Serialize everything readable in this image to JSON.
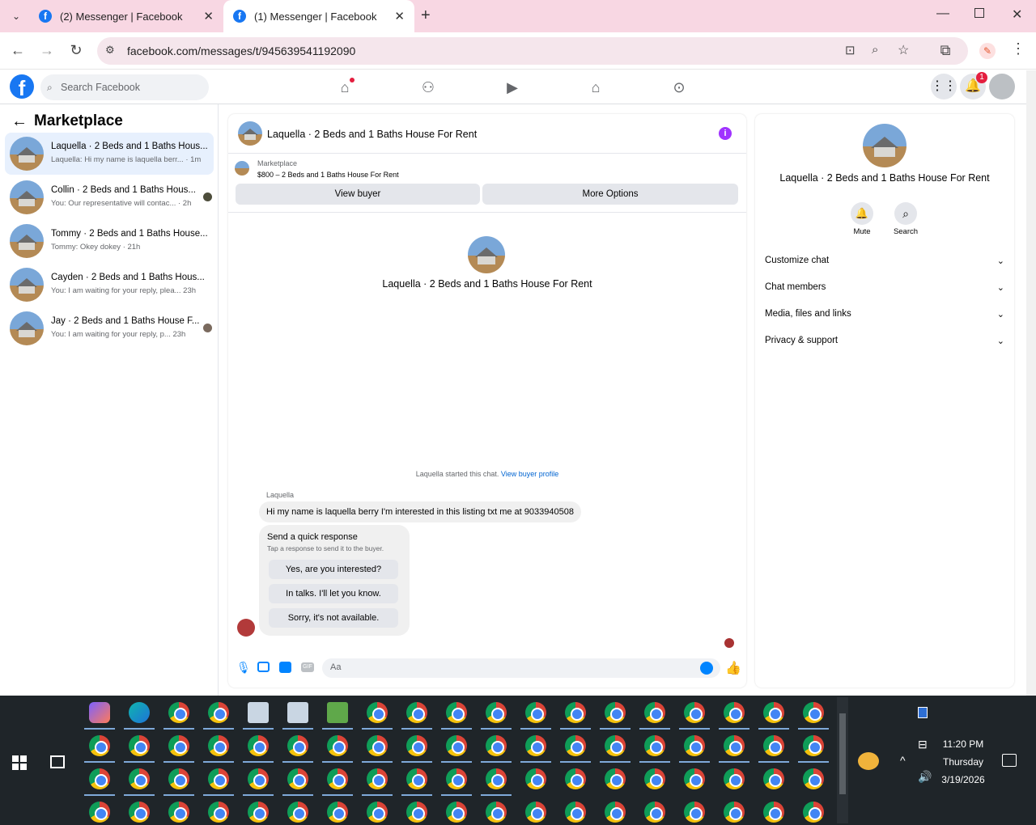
{
  "browser": {
    "tabs": [
      {
        "title": "(2) Messenger | Facebook"
      },
      {
        "title": "(1) Messenger | Facebook"
      }
    ],
    "url": "facebook.com/messages/t/945639541192090"
  },
  "fb": {
    "search_placeholder": "Search Facebook",
    "notification_count": "1"
  },
  "left": {
    "title": "Marketplace",
    "conversations": [
      {
        "name": "Laquella · 2 Beds and 1 Baths Hous...",
        "preview": "Laquella: Hi my name is laquella berr... · 1m"
      },
      {
        "name": "Collin · 2 Beds and 1 Baths Hous...",
        "preview": "You: Our representative will contac... · 2h"
      },
      {
        "name": "Tommy · 2 Beds and 1 Baths House...",
        "preview": "Tommy: Okey dokey · 21h"
      },
      {
        "name": "Cayden · 2 Beds and 1 Baths Hous...",
        "preview": "You: I am waiting for your reply, plea... 23h"
      },
      {
        "name": "Jay · 2 Beds and 1 Baths House F...",
        "preview": "You: I am waiting for your reply, p... 23h"
      }
    ]
  },
  "chat": {
    "header_title": "Laquella · 2 Beds and 1 Baths House For Rent",
    "listing_source": "Marketplace",
    "listing_line": "$800 – 2 Beds and 1 Baths House For Rent",
    "view_buyer": "View buyer",
    "more_options": "More Options",
    "center_title": "Laquella · 2 Beds and 1 Baths House For Rent",
    "started_text": "Laquella started this chat.",
    "view_buyer_profile": "View buyer profile",
    "sender": "Laquella",
    "message": "Hi my name is laquella berry I'm interested in this listing txt me at 9033940508",
    "quick_title": "Send a quick response",
    "quick_sub": "Tap a response to send it to the buyer.",
    "quick_responses": [
      "Yes, are you interested?",
      "In talks. I'll let you know.",
      "Sorry, it's not available."
    ],
    "input_placeholder": "Aa"
  },
  "right": {
    "title": "Laquella · 2 Beds and 1 Baths House For Rent",
    "mute": "Mute",
    "search": "Search",
    "sections": [
      "Customize chat",
      "Chat members",
      "Media, files and links",
      "Privacy & support"
    ]
  },
  "system": {
    "time": "11:20 PM",
    "day": "Thursday",
    "date": "3/19/2026"
  }
}
